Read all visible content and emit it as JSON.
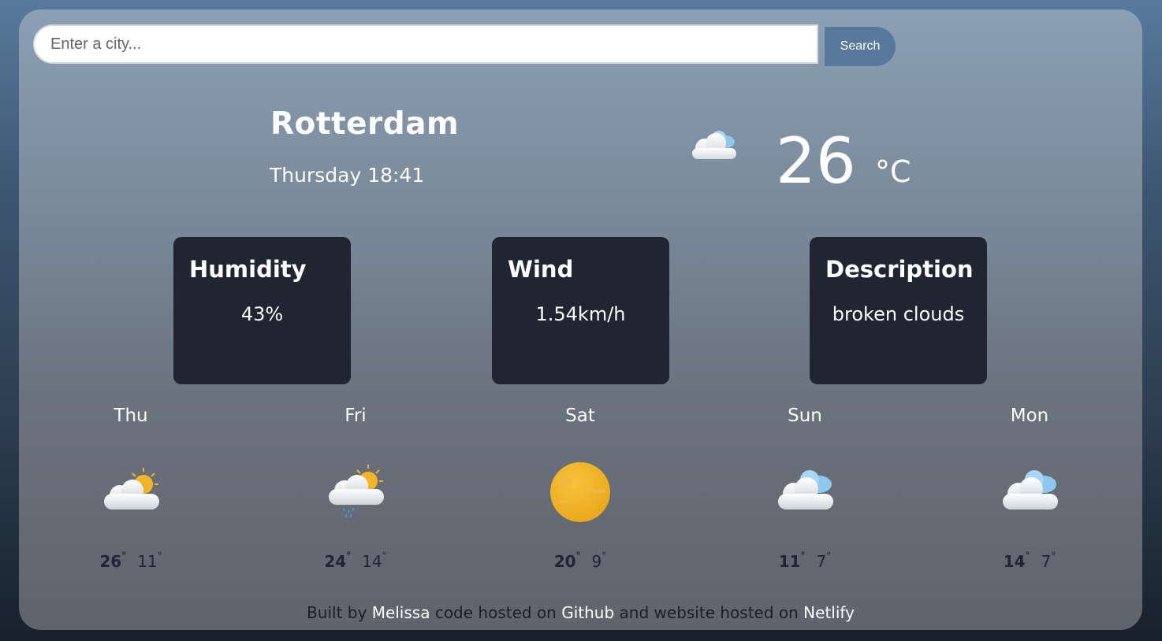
{
  "search": {
    "placeholder": "Enter a city...",
    "value": "",
    "button_label": "Search"
  },
  "current": {
    "city": "Rotterdam",
    "datetime": "Thursday 18:41",
    "temperature": "26",
    "unit": "°C",
    "icon": "broken-clouds-icon"
  },
  "stats": {
    "humidity": {
      "title": "Humidity",
      "value": "43%"
    },
    "wind": {
      "title": "Wind",
      "value": "1.54km/h"
    },
    "description": {
      "title": "Description",
      "value": "broken clouds"
    }
  },
  "forecast": [
    {
      "day": "Thu",
      "max": "26",
      "min": "11",
      "icon": "partly-cloudy-icon"
    },
    {
      "day": "Fri",
      "max": "24",
      "min": "14",
      "icon": "rain-sun-icon"
    },
    {
      "day": "Sat",
      "max": "20",
      "min": "9",
      "icon": "sun-icon"
    },
    {
      "day": "Sun",
      "max": "11",
      "min": "7",
      "icon": "clouds-icon"
    },
    {
      "day": "Mon",
      "max": "14",
      "min": "7",
      "icon": "clouds-icon"
    }
  ],
  "degree_symbol": "°",
  "footer": {
    "built_by": "Built by",
    "author": "Melissa",
    "code_hosted": "code hosted on",
    "github": "Github",
    "website_hosted": "and website hosted on",
    "netlify": "Netlify"
  }
}
